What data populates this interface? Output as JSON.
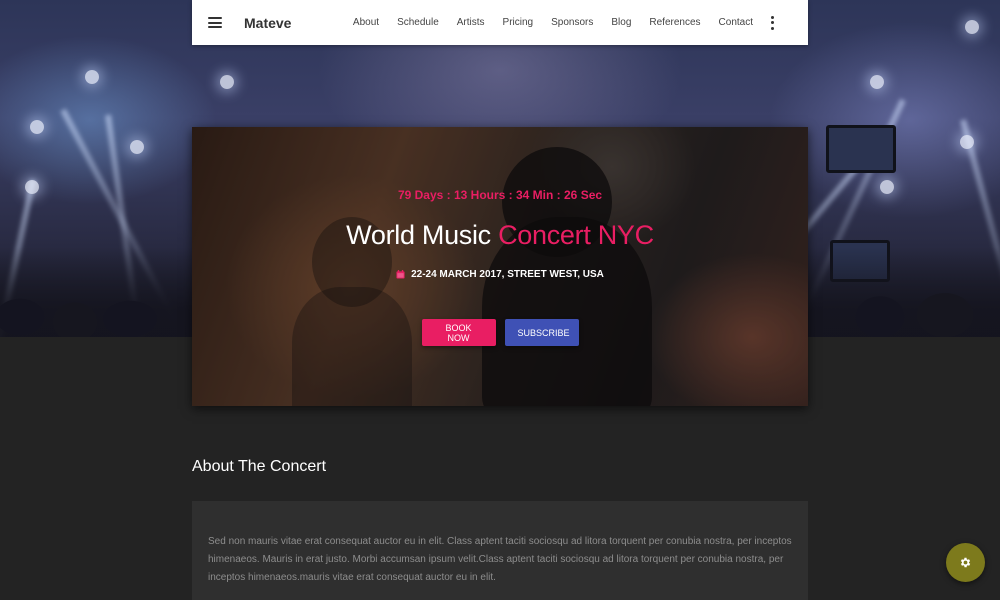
{
  "nav": {
    "brand": "Mateve",
    "links": [
      "About",
      "Schedule",
      "Artists",
      "Pricing",
      "Sponsors",
      "Blog",
      "References",
      "Contact"
    ]
  },
  "hero": {
    "countdown": "79 Days : 13 Hours : 34 Min : 26 Sec",
    "title_main": "World Music ",
    "title_accent": "Concert NYC",
    "meta": "22-24 MARCH 2017, STREET WEST, USA",
    "book_label": "BOOK NOW",
    "subscribe_label": "SUBSCRIBE"
  },
  "about": {
    "heading": "About The Concert",
    "text": "Sed non mauris vitae erat consequat auctor eu in elit. Class aptent taciti sociosqu ad litora torquent per conubia nostra, per inceptos himenaeos. Mauris in erat justo. Morbi accumsan ipsum velit.Class aptent taciti sociosqu ad litora torquent per conubia nostra, per inceptos himenaeos.mauris vitae erat consequat auctor eu in elit."
  },
  "colors": {
    "accent": "#e91e63",
    "primary": "#3f51b5",
    "background": "#212121",
    "card": "#2f2f2f",
    "fab": "#7d7a1c"
  },
  "icons": {
    "menu": "hamburger-menu-icon",
    "more": "more-vertical-icon",
    "date": "calendar-icon",
    "settings": "gear-icon"
  }
}
